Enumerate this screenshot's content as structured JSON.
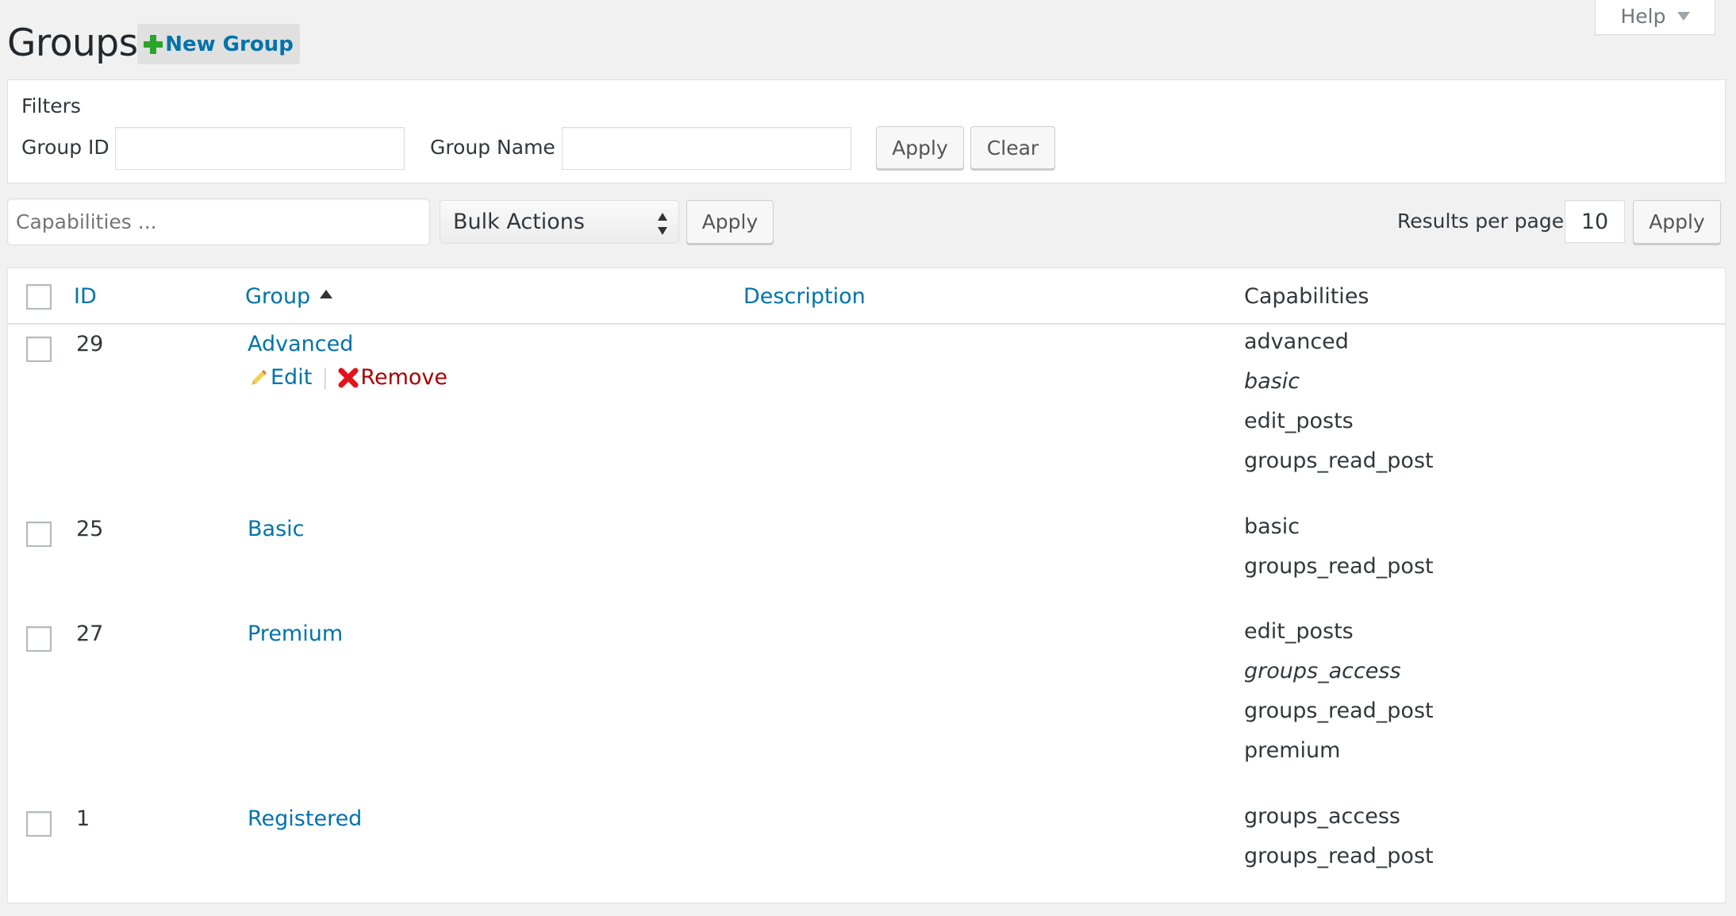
{
  "header": {
    "title": "Groups",
    "new_group_label": "New Group",
    "help_label": "Help"
  },
  "filters": {
    "title": "Filters",
    "group_id_label": "Group ID",
    "group_id_value": "",
    "group_name_label": "Group Name",
    "group_name_value": "",
    "apply_label": "Apply",
    "clear_label": "Clear"
  },
  "toolbar": {
    "capabilities_placeholder": "Capabilities ...",
    "capabilities_value": "",
    "bulk_actions_selected": "Bulk Actions",
    "apply_label": "Apply",
    "results_per_page_label": "Results per page",
    "results_per_page_value": "10",
    "results_apply_label": "Apply"
  },
  "table": {
    "columns": {
      "id": "ID",
      "group": "Group",
      "description": "Description",
      "capabilities": "Capabilities"
    },
    "sort": {
      "column": "group",
      "direction": "ascending"
    },
    "row_actions": {
      "edit_label": "Edit",
      "remove_label": "Remove"
    },
    "rows": [
      {
        "id": "29",
        "group": "Advanced",
        "description": "",
        "show_actions": true,
        "capabilities": [
          {
            "name": "advanced",
            "inherited": false
          },
          {
            "name": "basic",
            "inherited": true
          },
          {
            "name": "edit_posts",
            "inherited": false
          },
          {
            "name": "groups_read_post",
            "inherited": false
          }
        ]
      },
      {
        "id": "25",
        "group": "Basic",
        "description": "",
        "show_actions": false,
        "capabilities": [
          {
            "name": "basic",
            "inherited": false
          },
          {
            "name": "groups_read_post",
            "inherited": false
          }
        ]
      },
      {
        "id": "27",
        "group": "Premium",
        "description": "",
        "show_actions": false,
        "capabilities": [
          {
            "name": "edit_posts",
            "inherited": false
          },
          {
            "name": "groups_access",
            "inherited": true
          },
          {
            "name": "groups_read_post",
            "inherited": false
          },
          {
            "name": "premium",
            "inherited": false
          }
        ]
      },
      {
        "id": "1",
        "group": "Registered",
        "description": "",
        "show_actions": false,
        "capabilities": [
          {
            "name": "groups_access",
            "inherited": false
          },
          {
            "name": "groups_read_post",
            "inherited": false
          }
        ]
      }
    ]
  },
  "colors": {
    "link": "#0073aa",
    "remove": "#aa0000",
    "add_icon": "#2aa52a",
    "background": "#f1f1f1"
  }
}
